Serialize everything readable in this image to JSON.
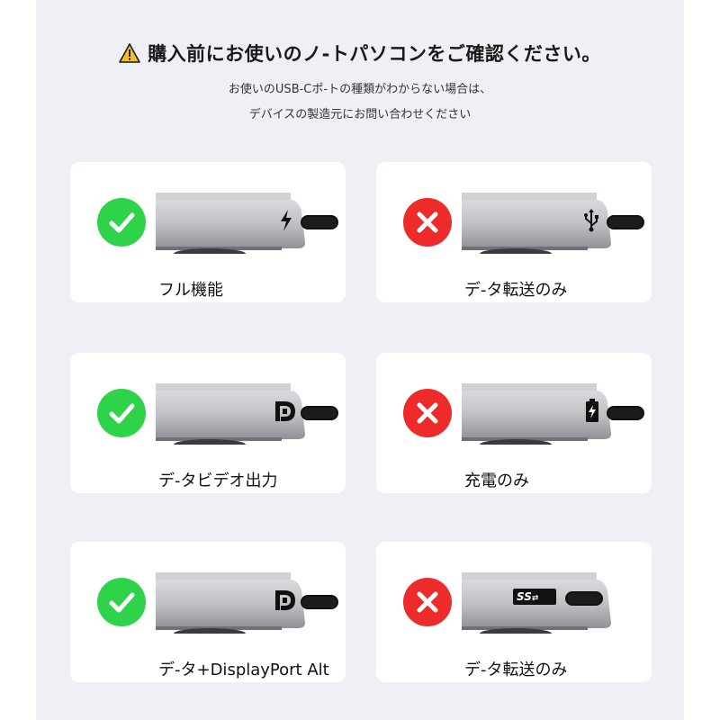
{
  "header": {
    "title": "購入前にお使いのノ-トパソコンをご確認ください。",
    "subtitle_line1": "お使いのUSB-Cポ-トの種類がわからない場合は、",
    "subtitle_line2": "デバイスの製造元にお問い合わせください"
  },
  "cards": [
    {
      "label": "フル機能",
      "status": "ok",
      "port_icon": "thunderbolt-icon"
    },
    {
      "label": "デ-タ転送のみ",
      "status": "ng",
      "port_icon": "usb-icon"
    },
    {
      "label": "デ-タビデオ出力",
      "status": "ok",
      "port_icon": "displayport-icon"
    },
    {
      "label": "充電のみ",
      "status": "ng",
      "port_icon": "battery-charge-icon"
    },
    {
      "label": "デ-タ+DisplayPort Alt",
      "status": "ok",
      "port_icon": "displayport-icon"
    },
    {
      "label": "デ-タ転送のみ",
      "status": "ng",
      "port_icon": "superspeed-usb-icon"
    }
  ],
  "colors": {
    "ok": "#2ed34a",
    "ng": "#ee2b2b",
    "warning": "#f2c21b",
    "panel_bg": "#eef0f5"
  },
  "ss_logo_text": "SS"
}
